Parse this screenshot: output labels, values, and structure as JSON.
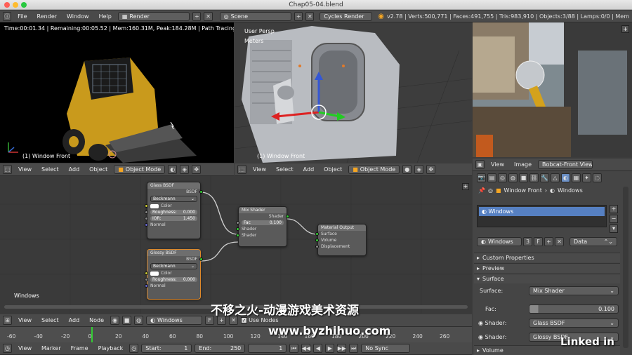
{
  "window": {
    "title": "Chap05-04.blend"
  },
  "info_header": {
    "menus": [
      "File",
      "Render",
      "Window",
      "Help"
    ],
    "layout": "Render",
    "scene": "Scene",
    "engine": "Cycles Render",
    "stats": "v2.78 | Verts:500,771 | Faces:491,755 | Tris:983,910 | Objects:3/88 | Lamps:0/0 | Mem"
  },
  "render_view": {
    "status": "Time:00:01.34 | Remaining:00:05.52 | Mem:160.31M, Peak:184.28M | Path Tracing Sa",
    "label": "(1) Window Front"
  },
  "solid_view": {
    "persp": "User Persp",
    "units": "Meters",
    "label": "(1) Window Front"
  },
  "view3d_header": {
    "menus": [
      "View",
      "Select",
      "Add",
      "Object"
    ],
    "mode": "Object Mode"
  },
  "image_header": {
    "menus": [
      "View",
      "Image"
    ],
    "image_name": "Bobcat-Front View..."
  },
  "nodes": {
    "glass": {
      "title": "Glass BSDF",
      "out": "BSDF",
      "dist": "Beckmann",
      "color": "Color",
      "rough_label": "Roughness:",
      "rough": "0.000",
      "ior_label": "IOR:",
      "ior": "1.450",
      "normal": "Normal"
    },
    "glossy": {
      "title": "Glossy BSDF",
      "out": "BSDF",
      "dist": "Beckmann",
      "color": "Color",
      "rough_label": "Roughness:",
      "rough": "0.000",
      "normal": "Normal"
    },
    "mix": {
      "title": "Mix Shader",
      "out": "Shader",
      "fac_label": "Fac",
      "fac": "0.100",
      "in1": "Shader",
      "in2": "Shader"
    },
    "output": {
      "title": "Material Output",
      "surface": "Surface",
      "volume": "Volume",
      "displacement": "Displacement"
    },
    "material_label": "Windows"
  },
  "node_header": {
    "menus": [
      "View",
      "Select",
      "Add",
      "Node"
    ],
    "material": "Windows",
    "use_nodes": "Use Nodes"
  },
  "timeline": {
    "ticks": [
      "-60",
      "-40",
      "-20",
      "0",
      "20",
      "40",
      "60",
      "80",
      "100",
      "120",
      "140",
      "160",
      "180",
      "200",
      "220",
      "240",
      "260"
    ],
    "menus": [
      "View",
      "Marker",
      "Frame",
      "Playback"
    ],
    "start_label": "Start:",
    "start": "1",
    "end_label": "End:",
    "end": "250",
    "current": "1",
    "sync": "No Sync"
  },
  "properties": {
    "breadcrumb_obj": "Window Front",
    "breadcrumb_mat": "Windows",
    "slot": "Windows",
    "mat_field": "Windows",
    "users": "3",
    "fake": "F",
    "link": "Data",
    "panels": {
      "custom": "Custom Properties",
      "preview": "Preview",
      "surface": "Surface",
      "volume": "Volume"
    },
    "surface_label": "Surface:",
    "surface_value": "Mix Shader",
    "fac_label": "Fac:",
    "fac_value": "0.100",
    "shader1_label": "Shader:",
    "shader1_value": "Glass BSDF",
    "shader2_label": "Shader:",
    "shader2_value": "Glossy BSDF"
  },
  "watermark": {
    "line1": "不移之火-动漫游戏美术资源",
    "line2": "www.byzhihuo.com",
    "brand": "Linked in"
  },
  "colors": {
    "accent_orange": "#f5a623",
    "selection_blue": "#5680c2",
    "bg": "#3c3c3c"
  }
}
